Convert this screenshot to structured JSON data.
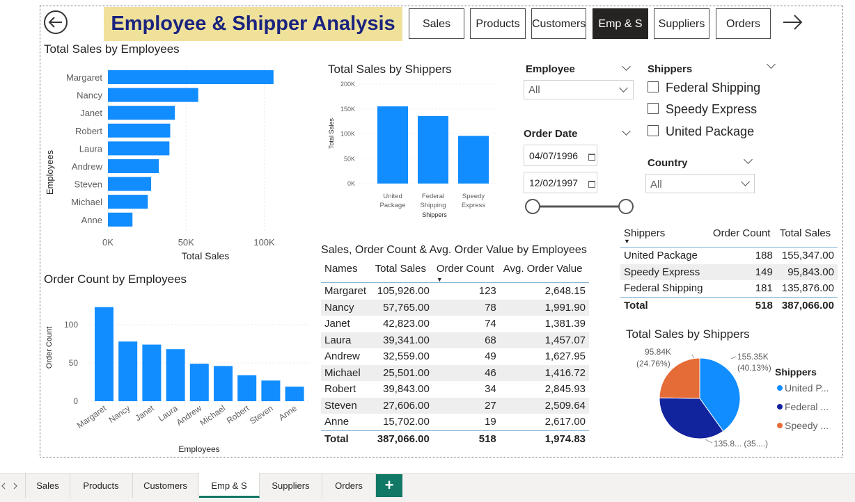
{
  "colors": {
    "bar": "#118dff",
    "navy": "#12239e",
    "orange": "#e66c37",
    "title_bg": "#f0e19a",
    "title_text": "#1a237e",
    "tab_accent": "#117865"
  },
  "header": {
    "title": "Employee & Shipper Analysis",
    "back_icon": "back-arrow-circle-icon",
    "next_icon": "right-arrow-icon",
    "nav": [
      "Sales",
      "Products",
      "Customers",
      "Emp & S",
      "Suppliers",
      "Orders"
    ],
    "active_nav": "Emp & S"
  },
  "emp_sales_chart": {
    "title": "Total Sales by Employees",
    "xlabel": "Total Sales",
    "ylabel": "Employees",
    "ticks": [
      "0K",
      "50K",
      "100K"
    ]
  },
  "order_count_chart": {
    "title": "Order Count by Employees",
    "xlabel": "Employees",
    "ylabel": "Order Count",
    "ticks": [
      "0",
      "50",
      "100"
    ]
  },
  "shipper_bar_chart": {
    "title": "Total Sales by Shippers",
    "xlabel": "Shippers",
    "ylabel": "Total Sales",
    "ticks": [
      "0K",
      "50K",
      "100K",
      "150K",
      "200K"
    ]
  },
  "chart_data": [
    {
      "type": "bar",
      "orientation": "horizontal",
      "title": "Total Sales by Employees",
      "xlabel": "Total Sales",
      "ylabel": "Employees",
      "categories": [
        "Margaret",
        "Nancy",
        "Janet",
        "Robert",
        "Laura",
        "Andrew",
        "Steven",
        "Michael",
        "Anne"
      ],
      "values": [
        105926,
        57765,
        42823,
        39843,
        39341,
        32559,
        27606,
        25501,
        15702
      ],
      "xlim": [
        0,
        110000
      ],
      "ticks": [
        0,
        50000,
        100000
      ]
    },
    {
      "type": "bar",
      "title": "Order Count by Employees",
      "xlabel": "Employees",
      "ylabel": "Order Count",
      "categories": [
        "Margaret",
        "Nancy",
        "Janet",
        "Laura",
        "Andrew",
        "Michael",
        "Robert",
        "Steven",
        "Anne"
      ],
      "values": [
        123,
        78,
        74,
        68,
        49,
        46,
        34,
        27,
        19
      ],
      "ylim": [
        0,
        130
      ],
      "ticks": [
        0,
        50,
        100
      ]
    },
    {
      "type": "bar",
      "title": "Total Sales by Shippers",
      "xlabel": "Shippers",
      "ylabel": "Total Sales",
      "categories": [
        "United Package",
        "Federal Shipping",
        "Speedy Express"
      ],
      "values": [
        155347,
        135876,
        95843
      ],
      "ylim": [
        0,
        200000
      ],
      "ticks": [
        0,
        50000,
        100000,
        150000,
        200000
      ]
    },
    {
      "type": "pie",
      "title": "Total Sales by Shippers",
      "legend_title": "Shippers",
      "categories": [
        "United Package",
        "Federal Shipping",
        "Speedy Express"
      ],
      "values": [
        155347,
        135876,
        95843
      ],
      "colors": [
        "#118dff",
        "#12239e",
        "#e66c37"
      ],
      "labels": [
        "155.35K (40.13%)",
        "135.8... (35....)",
        "95.84K (24.76%)"
      ]
    }
  ],
  "slicers": {
    "employee": {
      "label": "Employee",
      "value": "All"
    },
    "order_date": {
      "label": "Order Date",
      "start": "04/07/1996",
      "end": "12/02/1997"
    },
    "shippers": {
      "label": "Shippers",
      "options": [
        "Federal Shipping",
        "Speedy Express",
        "United Package"
      ]
    },
    "country": {
      "label": "Country",
      "value": "All"
    }
  },
  "employee_table": {
    "title": "Sales, Order Count & Avg. Order Value by Employees",
    "headers": [
      "Names",
      "Total Sales",
      "Order Count",
      "Avg. Order Value"
    ],
    "rows": [
      [
        "Margaret",
        "105,926.00",
        "123",
        "2,648.15"
      ],
      [
        "Nancy",
        "57,765.00",
        "78",
        "1,991.90"
      ],
      [
        "Janet",
        "42,823.00",
        "74",
        "1,381.39"
      ],
      [
        "Laura",
        "39,341.00",
        "68",
        "1,457.07"
      ],
      [
        "Andrew",
        "32,559.00",
        "49",
        "1,627.95"
      ],
      [
        "Michael",
        "25,501.00",
        "46",
        "1,416.72"
      ],
      [
        "Robert",
        "39,843.00",
        "34",
        "2,845.93"
      ],
      [
        "Steven",
        "27,606.00",
        "27",
        "2,509.64"
      ],
      [
        "Anne",
        "15,702.00",
        "19",
        "2,617.00"
      ]
    ],
    "total": [
      "Total",
      "387,066.00",
      "518",
      "1,974.83"
    ]
  },
  "shipper_table": {
    "headers": [
      "Shippers",
      "Order Count",
      "Total Sales"
    ],
    "rows": [
      [
        "United Package",
        "188",
        "155,347.00"
      ],
      [
        "Speedy Express",
        "149",
        "95,843.00"
      ],
      [
        "Federal Shipping",
        "181",
        "135,876.00"
      ]
    ],
    "total": [
      "Total",
      "518",
      "387,066.00"
    ]
  },
  "pie": {
    "title": "Total Sales by Shippers",
    "legend_title": "Shippers",
    "legend": [
      "United P...",
      "Federal ...",
      "Speedy ..."
    ],
    "label_united_1": "155.35K",
    "label_united_2": "(40.13%)",
    "label_speedy_1": "95.84K",
    "label_speedy_2": "(24.76%)",
    "label_federal": "135.8... (35....)"
  },
  "tabs": [
    "Sales",
    "Products",
    "Customers",
    "Emp & S",
    "Suppliers",
    "Orders"
  ],
  "active_tab": "Emp & S",
  "add_tab_label": "+"
}
